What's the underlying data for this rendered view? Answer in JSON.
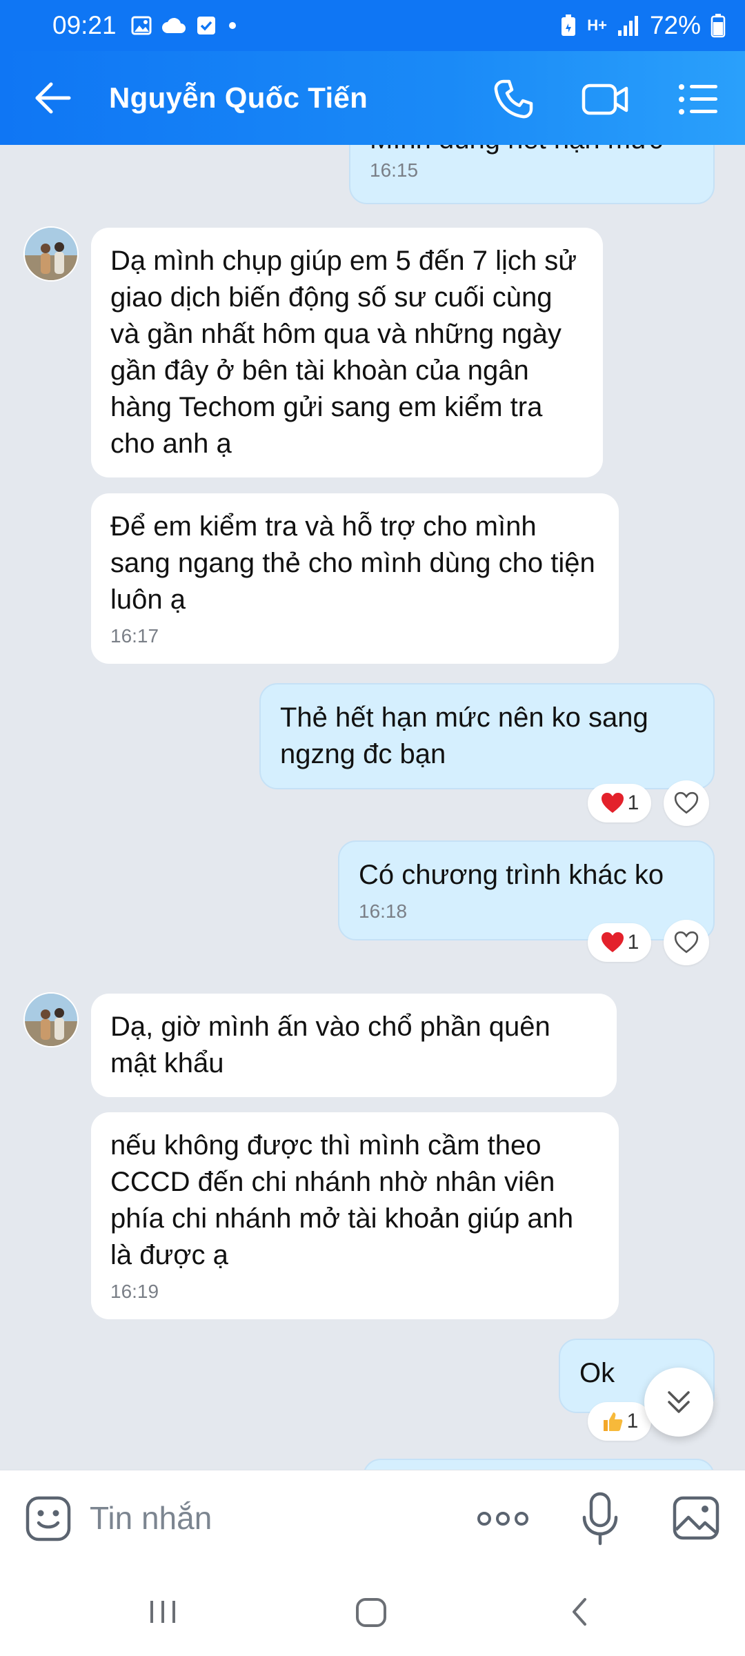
{
  "status_bar": {
    "time": "09:21",
    "battery": "72%",
    "network": "H+"
  },
  "header": {
    "title": "Nguyễn Quốc Tiến",
    "icons": [
      "back-arrow-icon",
      "phone-icon",
      "video-icon",
      "menu-list-icon"
    ]
  },
  "messages": [
    {
      "id": "m0",
      "side": "out",
      "text": "Mình dùng hết hạn mức",
      "time": "16:15"
    },
    {
      "id": "m1",
      "side": "in",
      "text": "Dạ mình chụp giúp em 5 đến 7 lịch sử giao dịch biến động số sư cuối cùng và gần nhất hôm qua và những ngày gần đây ở bên tài khoàn của ngân hàng Techom gửi sang em kiểm tra cho anh ạ",
      "time": ""
    },
    {
      "id": "m2",
      "side": "in",
      "text": "Để em kiểm tra và hỗ trợ cho mình sang ngang thẻ cho mình dùng cho tiện luôn ạ",
      "time": "16:17"
    },
    {
      "id": "m3",
      "side": "out",
      "text": "Thẻ hết hạn mức nên ko sang ngzng đc bạn",
      "time": "",
      "reaction": "1"
    },
    {
      "id": "m4",
      "side": "out",
      "text": "Có chương trình khác ko",
      "time": "16:18",
      "reaction": "1"
    },
    {
      "id": "m5",
      "side": "in",
      "text": "Dạ, giờ mình ấn vào chổ phần quên mật khẩu",
      "time": ""
    },
    {
      "id": "m6",
      "side": "in",
      "text": "nếu không được thì mình cầm theo CCCD đến chi nhánh nhờ nhân viên phía chi nhánh mở tài khoản giúp anh là được ạ",
      "time": "16:19"
    },
    {
      "id": "m7",
      "side": "out",
      "text": "Ok",
      "time": "",
      "reaction": "1"
    }
  ],
  "input": {
    "placeholder": "Tin nhắn"
  },
  "colors": {
    "brand": "#0f76f4",
    "outgoing_bubble": "#d5effe",
    "incoming_bubble": "#ffffff",
    "chat_bg": "#e4e8ee"
  }
}
